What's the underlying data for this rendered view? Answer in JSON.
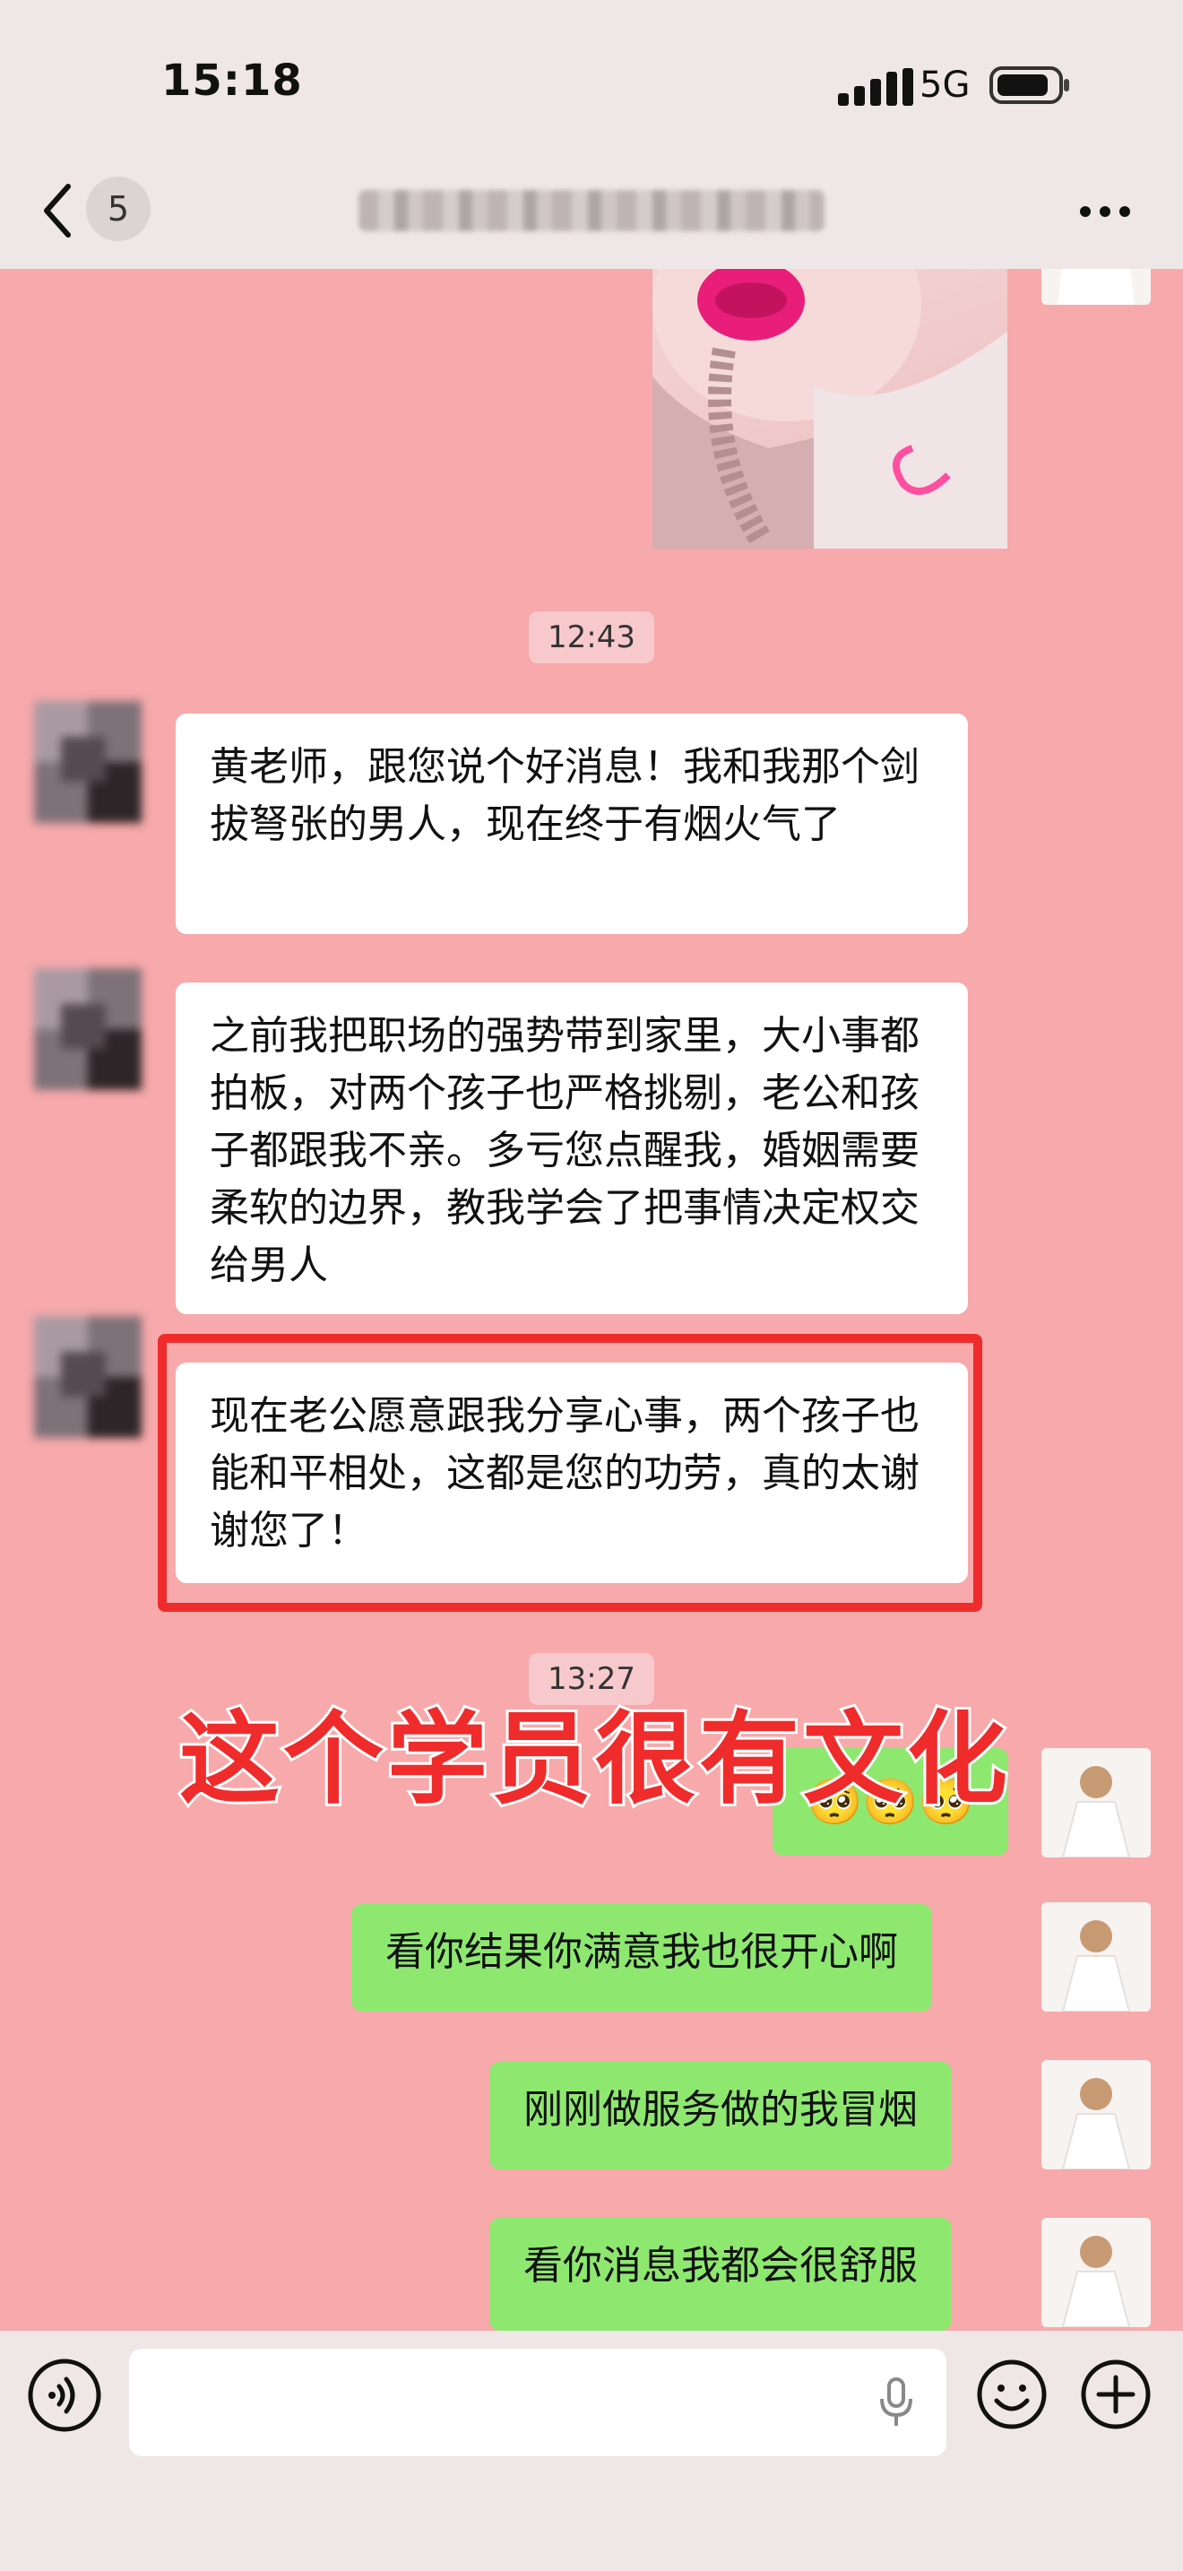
{
  "status_bar": {
    "time": "15:18",
    "network": "5G"
  },
  "header": {
    "unread_count": "5"
  },
  "chat": {
    "timestamp_1": "12:43",
    "msg_1": "黄老师，跟您说个好消息！我和我那个剑拔弩张的男人，现在终于有烟火气了",
    "msg_2": "之前我把职场的强势带到家里，大小事都拍板，对两个孩子也严格挑剔，老公和孩子都跟我不亲。多亏您点醒我，婚姻需要柔软的边界，教我学会了把事情决定权交给男人",
    "msg_3": "现在老公愿意跟我分享心事，两个孩子也能和平相处，这都是您的功劳，真的太谢谢您了！",
    "timestamp_2": "13:27",
    "reply_emoji": "🥺🥺🥺",
    "reply_1": "看你结果你满意我也很开心啊",
    "reply_2": "刚刚做服务做的我冒烟",
    "reply_3": "看你消息我都会很舒服"
  },
  "overlay": {
    "caption": "这个学员很有文化"
  },
  "colors": {
    "chat_bg": "#f7a9ab",
    "outgoing_bubble": "#8ee870",
    "highlight": "#ef2b2b"
  }
}
